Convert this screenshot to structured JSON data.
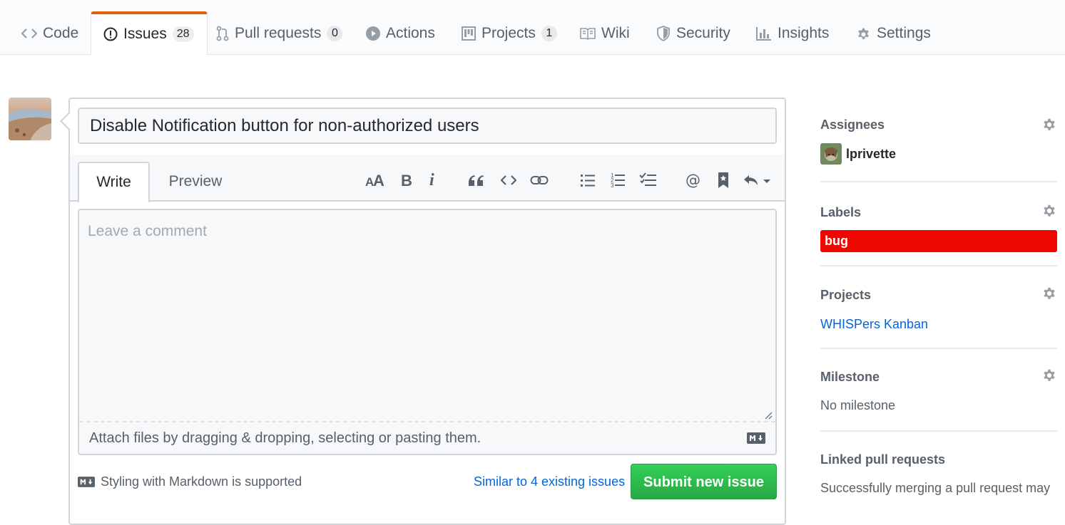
{
  "nav": {
    "tabs": [
      {
        "label": "Code",
        "icon": "code-icon"
      },
      {
        "label": "Issues",
        "icon": "issue-opened-icon",
        "count": "28",
        "selected": true
      },
      {
        "label": "Pull requests",
        "icon": "git-pull-request-icon",
        "count": "0"
      },
      {
        "label": "Actions",
        "icon": "play-icon"
      },
      {
        "label": "Projects",
        "icon": "project-icon",
        "count": "1"
      },
      {
        "label": "Wiki",
        "icon": "book-icon"
      },
      {
        "label": "Security",
        "icon": "shield-icon"
      },
      {
        "label": "Insights",
        "icon": "graph-icon"
      },
      {
        "label": "Settings",
        "icon": "gear-icon"
      }
    ],
    "accent_color": "#e36209"
  },
  "issue_form": {
    "title_value": "Disable Notification button for non-authorized users",
    "tab_write": "Write",
    "tab_preview": "Preview",
    "toolbar_icons": [
      "text-size-icon",
      "bold-icon",
      "italic-icon",
      "quote-icon",
      "code-icon",
      "link-icon",
      "unordered-list-icon",
      "ordered-list-icon",
      "tasklist-icon",
      "mention-icon",
      "saved-reply-icon",
      "reply-icon"
    ],
    "comment_placeholder": "Leave a comment",
    "comment_value": "",
    "attach_text": "Attach files by dragging & dropping, selecting or pasting them.",
    "markdown_note": "Styling with Markdown is supported",
    "similar_link": "Similar to 4 existing issues",
    "submit_label": "Submit new issue",
    "submit_color": "#28a745"
  },
  "sidebar": {
    "assignees": {
      "heading": "Assignees",
      "user": "lprivette"
    },
    "labels": {
      "heading": "Labels",
      "items": [
        {
          "name": "bug",
          "color": "#ee0701"
        }
      ]
    },
    "projects": {
      "heading": "Projects",
      "item": "WHISPers Kanban"
    },
    "milestone": {
      "heading": "Milestone",
      "value": "No milestone"
    },
    "linked_prs": {
      "heading": "Linked pull requests",
      "text": "Successfully merging a pull request may"
    }
  }
}
